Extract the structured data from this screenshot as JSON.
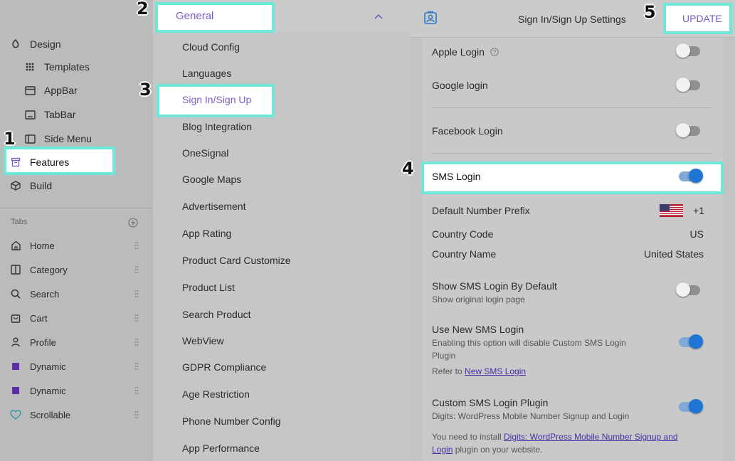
{
  "sidebar": {
    "design": "Design",
    "templates": "Templates",
    "appbar": "AppBar",
    "tabbar": "TabBar",
    "sidemenu": "Side Menu",
    "features": "Features",
    "build": "Build",
    "tabs_label": "Tabs",
    "tabs": [
      "Home",
      "Category",
      "Search",
      "Cart",
      "Profile",
      "Dynamic",
      "Dynamic",
      "Scrollable"
    ]
  },
  "middle": {
    "group": "General",
    "items": [
      "Cloud Config",
      "Languages",
      "Sign In/Sign Up",
      "Blog Integration",
      "OneSignal",
      "Google Maps",
      "Advertisement",
      "App Rating",
      "Product Card Customize",
      "Product List",
      "Search Product",
      "WebView",
      "GDPR Compliance",
      "Age Restriction",
      "Phone Number Config",
      "App Performance"
    ]
  },
  "right": {
    "title": "Sign In/Sign Up Settings",
    "update": "UPDATE",
    "apple": "Apple Login",
    "google": "Google login",
    "facebook": "Facebook Login",
    "sms": "SMS Login",
    "prefix_label": "Default Number Prefix",
    "prefix_value": "+1",
    "country_code_label": "Country Code",
    "country_code_value": "US",
    "country_name_label": "Country Name",
    "country_name_value": "United States",
    "show_default": "Show SMS Login By Default",
    "show_default_sub": "Show original login page",
    "new_sms": "Use New SMS Login",
    "new_sms_sub": "Enabling this option will disable Custom SMS Login Plugin",
    "refer_to": "Refer to",
    "new_sms_link": "New SMS Login",
    "custom_plugin": "Custom SMS Login Plugin",
    "custom_plugin_sub": "Digits: WordPress Mobile Number Signup and Login",
    "install_pre": "You need to install",
    "install_link": "Digits: WordPress Mobile Number Signup and Login",
    "install_post": "plugin on your website."
  },
  "toggles": {
    "apple": false,
    "google": false,
    "facebook": false,
    "sms": true,
    "show_default": false,
    "new_sms": true,
    "custom_plugin": true
  },
  "callouts": [
    "1",
    "2",
    "3",
    "4",
    "5"
  ],
  "colors": {
    "accent": "#7b5cc9",
    "highlight_border": "#6ee9d8",
    "toggle_on": "#1f75d3",
    "link": "#4a2ea7"
  }
}
